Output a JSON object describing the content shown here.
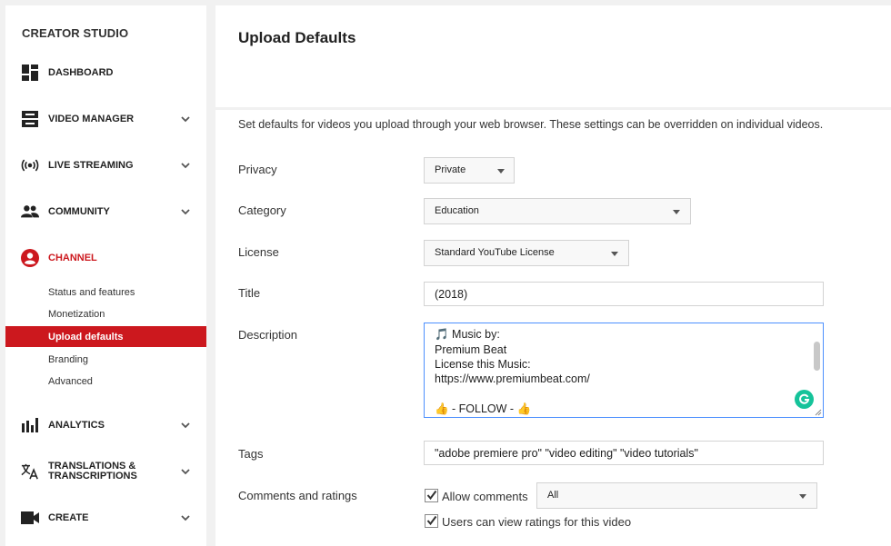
{
  "sidebar": {
    "brand": "CREATOR STUDIO",
    "items": [
      {
        "label": "DASHBOARD"
      },
      {
        "label": "VIDEO MANAGER"
      },
      {
        "label": "LIVE STREAMING"
      },
      {
        "label": "COMMUNITY"
      },
      {
        "label": "CHANNEL"
      },
      {
        "label": "ANALYTICS"
      },
      {
        "label_line1": "TRANSLATIONS &",
        "label_line2": "TRANSCRIPTIONS"
      },
      {
        "label": "CREATE"
      }
    ],
    "channel_sub": [
      {
        "label": "Status and features"
      },
      {
        "label": "Monetization"
      },
      {
        "label": "Upload defaults"
      },
      {
        "label": "Branding"
      },
      {
        "label": "Advanced"
      }
    ],
    "accent_color": "#cc181e"
  },
  "header": {
    "title": "Upload Defaults"
  },
  "form": {
    "intro": "Set defaults for videos you upload through your web browser. These settings can be overridden on individual videos.",
    "privacy": {
      "label": "Privacy",
      "value": "Private"
    },
    "category": {
      "label": "Category",
      "value": "Education"
    },
    "license": {
      "label": "License",
      "value": "Standard YouTube License"
    },
    "title": {
      "label": "Title",
      "value": "(2018)"
    },
    "description": {
      "label": "Description",
      "lines": [
        "🎵  Music by:",
        "Premium Beat",
        "License this Music:",
        "https://www.premiumbeat.com/",
        "",
        "👍  - FOLLOW - 👍"
      ]
    },
    "tags": {
      "label": "Tags",
      "value": "\"adobe premiere pro\" \"video editing\" \"video tutorials\""
    },
    "comments": {
      "label": "Comments and ratings",
      "allow_comments_label": "Allow comments",
      "allow_comments_checked": true,
      "comments_select_value": "All",
      "ratings_label": "Users can view ratings for this video",
      "ratings_checked": true
    }
  },
  "icons": {
    "dashboard": "dashboard-icon",
    "video_manager": "video-manager-icon",
    "live": "live-streaming-icon",
    "community": "community-icon",
    "channel": "channel-icon",
    "analytics": "analytics-icon",
    "translations": "translate-icon",
    "create": "video-camera-icon",
    "grammarly": "grammarly-icon"
  }
}
